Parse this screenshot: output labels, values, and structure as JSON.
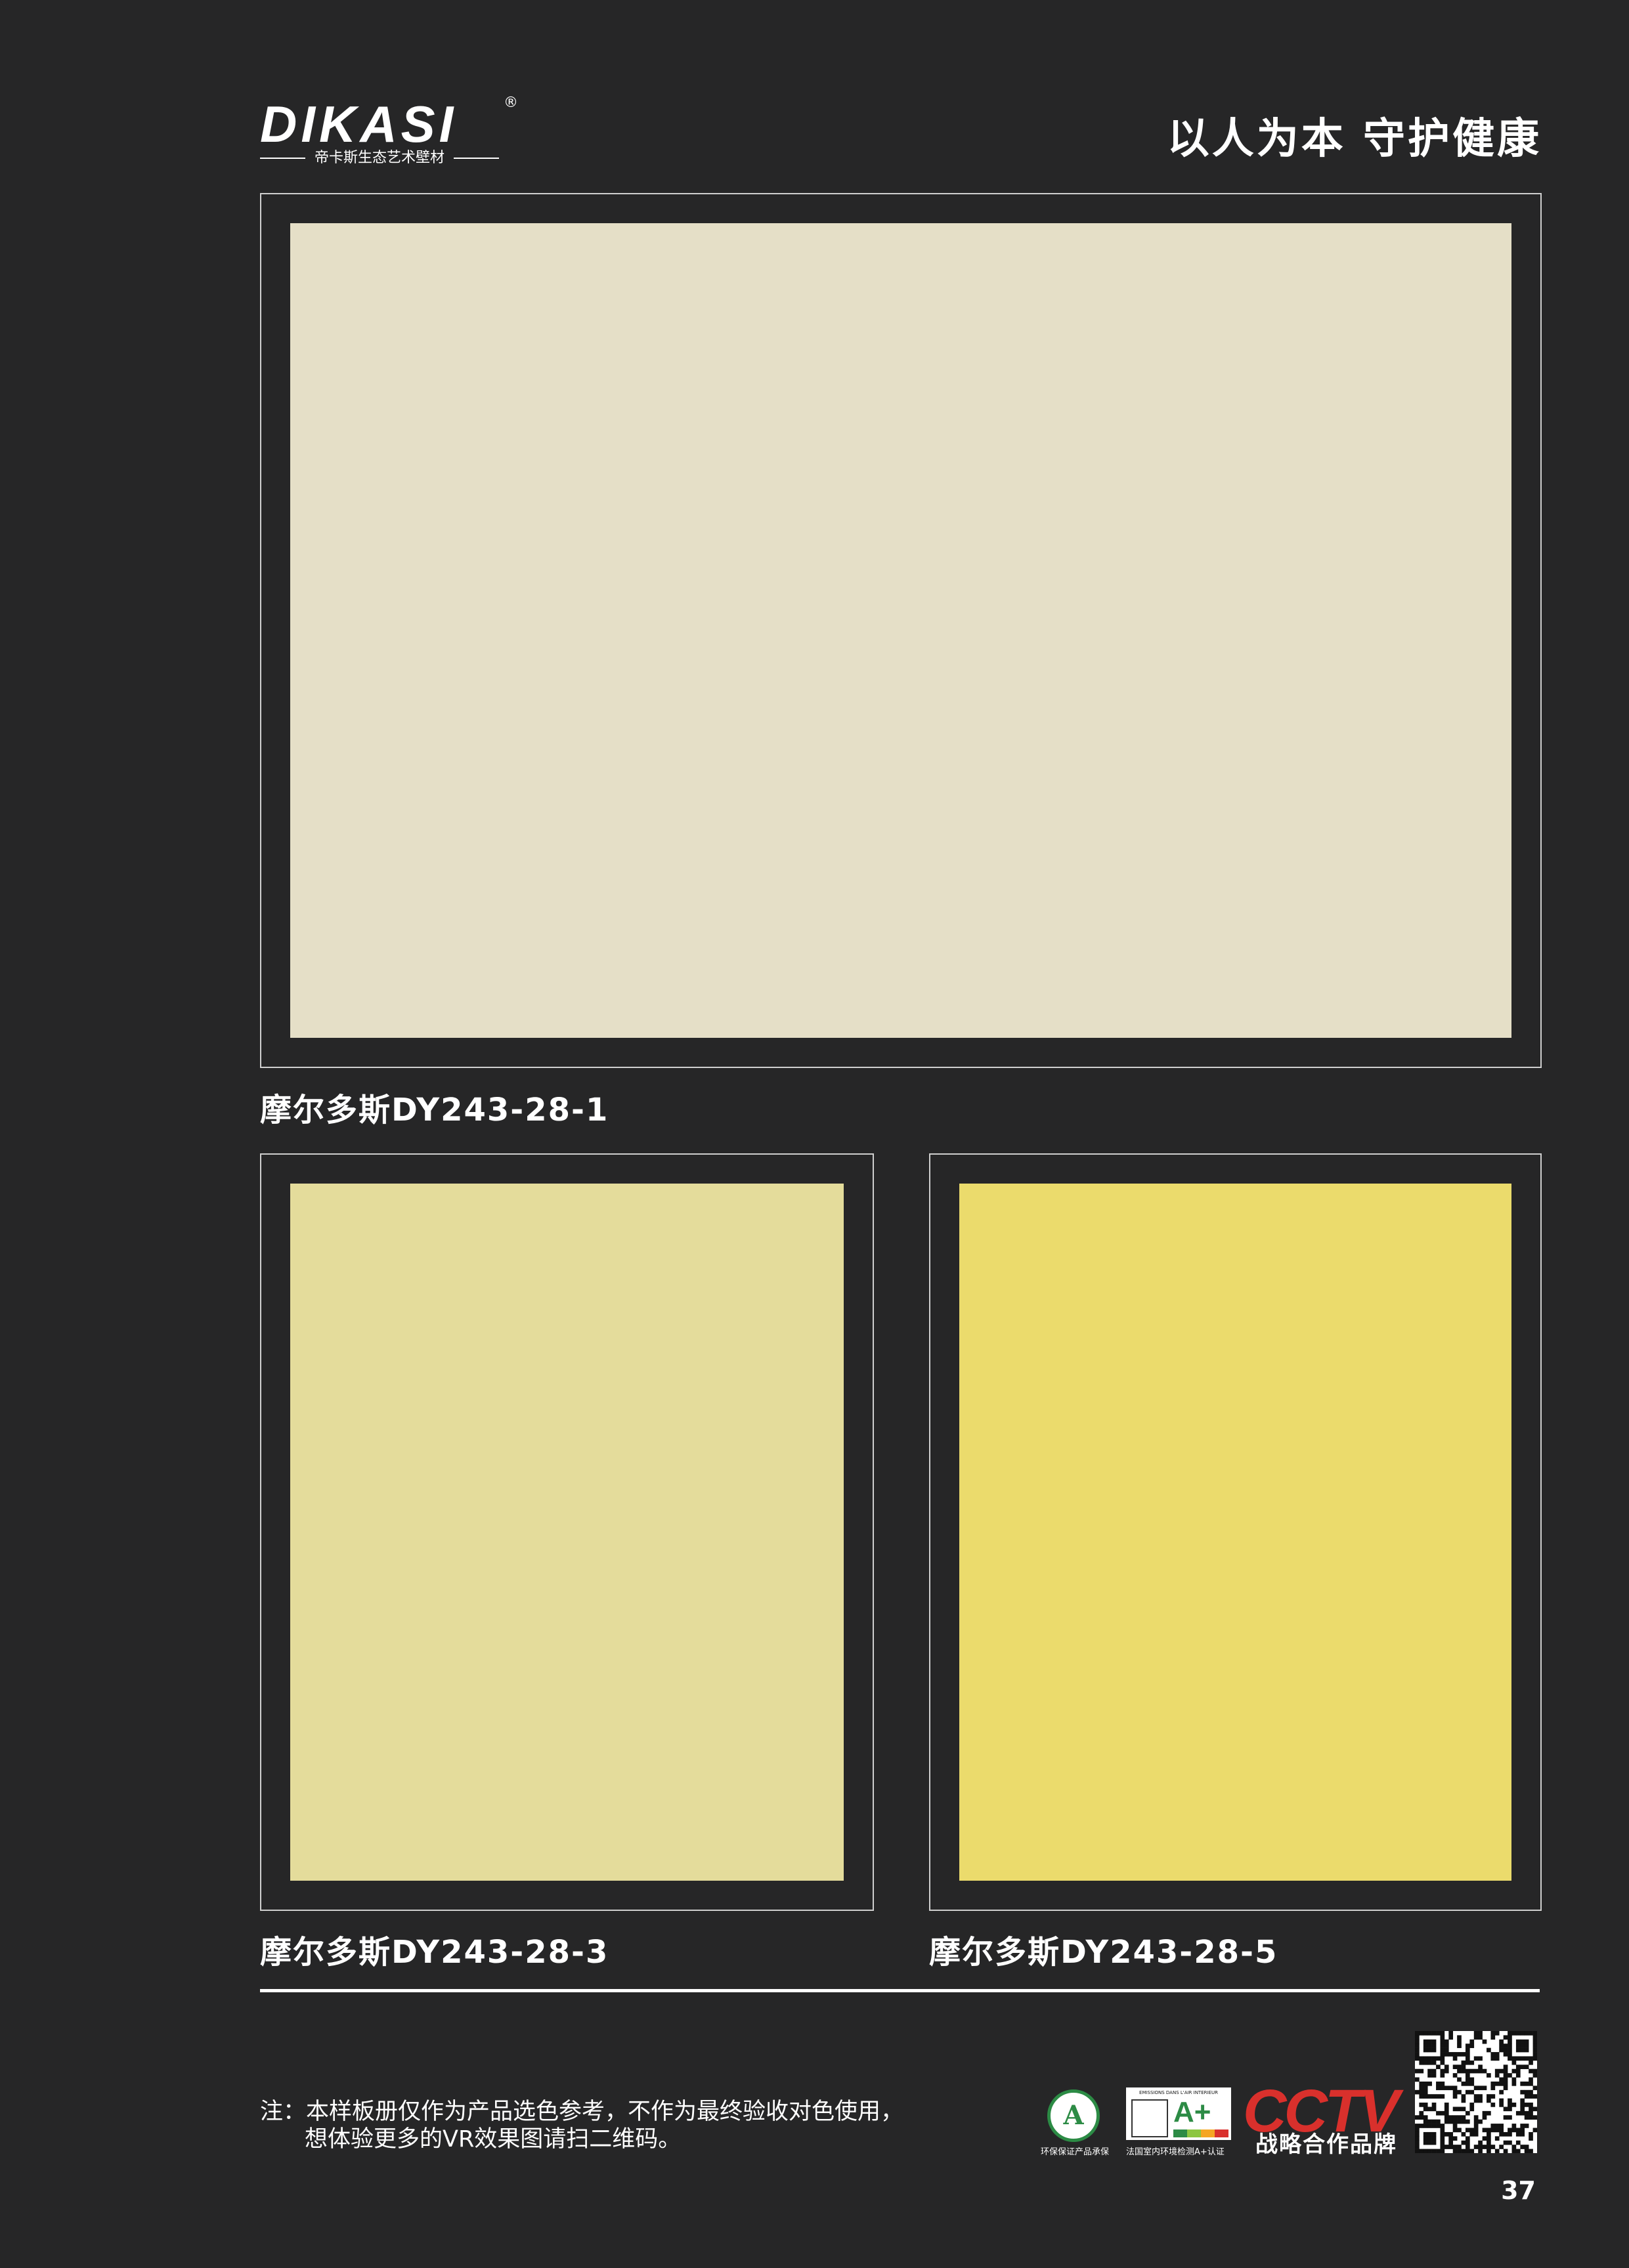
{
  "header": {
    "logo_text": "DIKASI",
    "logo_registered": "®",
    "logo_subtitle": "帝卡斯生态艺术壁材",
    "slogan": "以人为本  守护健康"
  },
  "swatches": [
    {
      "label": "摩尔多斯DY243-28-1",
      "color": "#e5dfc7"
    },
    {
      "label": "摩尔多斯DY243-28-3",
      "color": "#e4dc9b"
    },
    {
      "label": "摩尔多斯DY243-28-5",
      "color": "#ebdb6c"
    }
  ],
  "note": {
    "line1": "注：本样板册仅作为产品选色参考，不作为最终验收对色使用，",
    "line2": "想体验更多的VR效果图请扫二维码。"
  },
  "certifications": {
    "badge1_glyph": "A",
    "badge1_caption": "环保保证产品承保",
    "badge2_header": "EMISSIONS DANS L'AIR INTERIEUR",
    "badge2_grade": "A+",
    "badge2_caption": "法国室内环境检测A+认证",
    "cctv_logo": "CCTV",
    "cctv_caption": "战略合作品牌"
  },
  "colors": {
    "background": "#262627",
    "frame_border": "#cfcfcf",
    "cert_green": "#2c8b45",
    "cctv_red": "#d9302c"
  },
  "page_number": "37"
}
